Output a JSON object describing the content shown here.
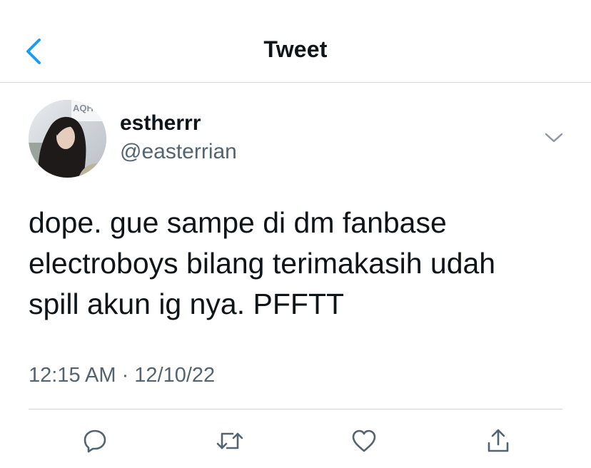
{
  "header": {
    "title": "Tweet",
    "back_icon": "chevron-left-icon"
  },
  "author": {
    "name": "estherrr",
    "handle": "@easterrian",
    "avatar_text": "AQH",
    "more_icon": "chevron-down-icon"
  },
  "tweet": {
    "lines": [
      "dope. gue sampe di dm fanbase",
      "electroboys bilang terimakasih udah",
      "spill akun ig nya. PFFTT"
    ],
    "timestamp": "12:15 AM · 12/10/22"
  },
  "actions": [
    {
      "name": "reply",
      "icon": "reply-icon"
    },
    {
      "name": "retweet",
      "icon": "retweet-icon"
    },
    {
      "name": "like",
      "icon": "heart-icon"
    },
    {
      "name": "share",
      "icon": "share-icon"
    }
  ],
  "colors": {
    "accent": "#1d9bf0",
    "text_primary": "#0f1419",
    "text_secondary": "#536471",
    "divider": "#d5d9dc"
  }
}
